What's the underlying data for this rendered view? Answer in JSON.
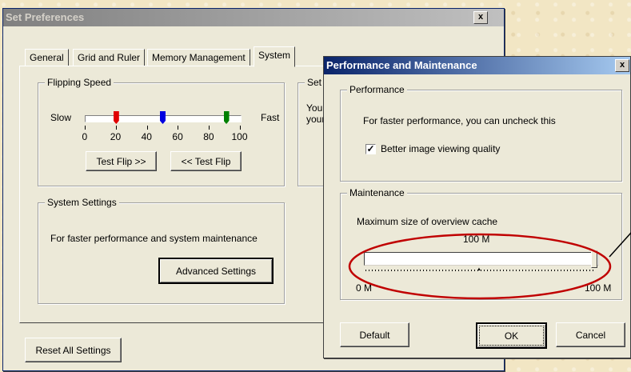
{
  "main_window": {
    "title": "Set Preferences",
    "close_glyph": "x",
    "tabs": [
      {
        "label": "General",
        "selected": false
      },
      {
        "label": "Grid and Ruler",
        "selected": false
      },
      {
        "label": "Memory Management",
        "selected": false
      },
      {
        "label": "System",
        "selected": true
      }
    ],
    "flipping": {
      "group_label": "Flipping Speed",
      "slow_label": "Slow",
      "fast_label": "Fast",
      "ticks": [
        "0",
        "20",
        "40",
        "60",
        "80",
        "100"
      ],
      "markers": [
        {
          "color": "#e00000",
          "value": 20
        },
        {
          "color": "#0000e0",
          "value": 50
        },
        {
          "color": "#008000",
          "value": 91
        }
      ],
      "test_flip_forward": "Test Flip >>",
      "test_flip_back": "<< Test Flip"
    },
    "other_group": {
      "label": "Set",
      "text_line1": "You",
      "text_line2": "your"
    },
    "system_settings": {
      "group_label": "System Settings",
      "description": "For faster performance and system maintenance",
      "advanced_button": "Advanced Settings"
    },
    "reset_button": "Reset All Settings"
  },
  "dialog": {
    "title": "Performance and Maintenance",
    "close_glyph": "x",
    "performance": {
      "group_label": "Performance",
      "description": "For faster performance, you can uncheck this",
      "checkbox_label": "Better image viewing quality",
      "checkbox_checked": true
    },
    "maintenance": {
      "group_label": "Maintenance",
      "cache_label": "Maximum size of overview cache",
      "cache_value": "100 M",
      "slider_fraction": 1.0,
      "min_label": "0 M",
      "max_label": "100 M"
    },
    "default_button": "Default",
    "ok_button": "OK",
    "cancel_button": "Cancel"
  },
  "colors": {
    "highlight_ellipse": "#c00000"
  }
}
